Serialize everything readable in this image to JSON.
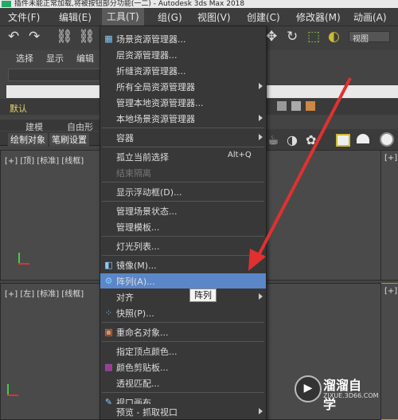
{
  "window": {
    "title": "插件未能正常加载,将被按钮部分功能(一二) - Autodesk 3ds Max 2018"
  },
  "menubar": [
    {
      "label": "文件(F)"
    },
    {
      "label": "编辑(E)"
    },
    {
      "label": "工具(T)"
    },
    {
      "label": "组(G)"
    },
    {
      "label": "视图(V)"
    },
    {
      "label": "创建(C)"
    },
    {
      "label": "修改器(M)"
    },
    {
      "label": "动画(A)"
    }
  ],
  "toolbar": {
    "view_dropdown": "视图"
  },
  "left_panel": {
    "row_labels": [
      "选择",
      "显示",
      "编辑"
    ],
    "default_label": "默认",
    "tabs": [
      "建模",
      "自由形式"
    ],
    "subtabs": [
      "绘制对象",
      "笔刷设置"
    ]
  },
  "viewports": {
    "top": "[+] [顶] [标准] [线框]",
    "left": "[+] [左] [标准] [线框]",
    "top_right": "[+]",
    "bottom_right": "[+]"
  },
  "tools_menu": {
    "items": [
      {
        "label": "场景资源管理器...",
        "icon": "grid-icon"
      },
      {
        "label": "层资源管理器..."
      },
      {
        "label": "折缝资源管理器..."
      },
      {
        "label": "所有全局资源管理器",
        "submenu": true
      },
      {
        "label": "管理本地资源管理器..."
      },
      {
        "label": "本地场景资源管理器",
        "submenu": true
      },
      {
        "label": "容器",
        "submenu": true
      },
      {
        "label": "孤立当前选择",
        "shortcut": "Alt+Q"
      },
      {
        "label": "结束隔离",
        "disabled": true
      },
      {
        "label": "显示浮动框(D)..."
      },
      {
        "label": "管理场景状态..."
      },
      {
        "label": "管理模板..."
      },
      {
        "label": "灯光列表..."
      },
      {
        "label": "镜像(M)...",
        "icon": "mirror-icon"
      },
      {
        "label": "阵列(A)...",
        "icon": "array-icon",
        "highlighted": true
      },
      {
        "label": "对齐",
        "submenu": true
      },
      {
        "label": "快照(P)...",
        "icon": "snapshot-icon"
      },
      {
        "label": "重命名对象...",
        "icon": "rename-icon"
      },
      {
        "label": "指定顶点颜色..."
      },
      {
        "label": "颜色剪贴板...",
        "icon": "color-clipboard-icon"
      },
      {
        "label": "透视匹配..."
      },
      {
        "label": "视口画布...",
        "icon": "canvas-icon"
      },
      {
        "label": "预览 - 抓取视口",
        "submenu": true
      }
    ]
  },
  "tooltip": {
    "text": "阵列"
  },
  "watermark": {
    "title": "溜溜自学",
    "url": "ZIXUE.3D66.COM"
  },
  "colors": {
    "highlight": "#5b87c9",
    "arrow": "#e23030",
    "menu_bg": "#383838"
  }
}
